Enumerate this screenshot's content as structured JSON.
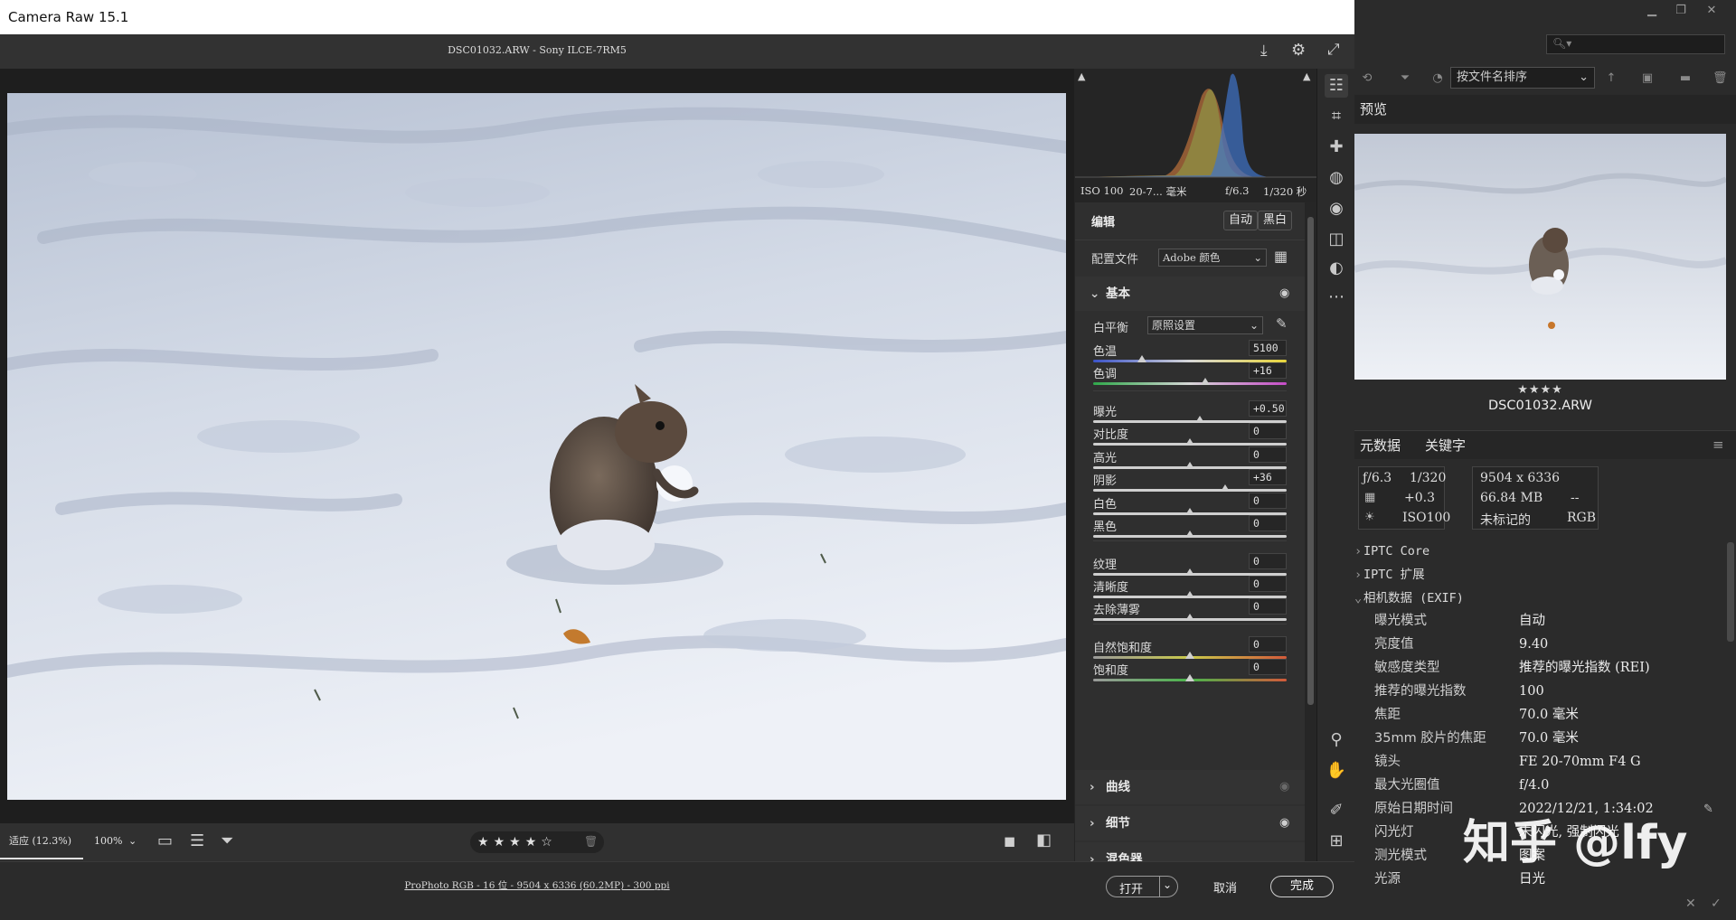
{
  "window": {
    "title": "Camera Raw 15.1",
    "file_header": "DSC01032.ARW -  Sony ILCE-7RM5"
  },
  "histogram": {
    "iso": "ISO 100",
    "focal": "20-7... 毫米",
    "aperture": "f/6.3",
    "shutter": "1/320 秒"
  },
  "edit_panel": {
    "edit_label": "编辑",
    "auto_button": "自动",
    "bw_button": "黑白",
    "profile_label": "配置文件",
    "profile_value": "Adobe 颜色",
    "basic_label": "基本",
    "wb_label": "白平衡",
    "wb_value": "原照设置",
    "sliders": [
      {
        "label": "色温",
        "value": "5100",
        "pos": 0.25
      },
      {
        "label": "色调",
        "value": "+16",
        "pos": 0.58
      },
      {
        "label": "曝光",
        "value": "+0.50",
        "pos": 0.55
      },
      {
        "label": "对比度",
        "value": "0",
        "pos": 0.5
      },
      {
        "label": "高光",
        "value": "0",
        "pos": 0.5
      },
      {
        "label": "阴影",
        "value": "+36",
        "pos": 0.68
      },
      {
        "label": "白色",
        "value": "0",
        "pos": 0.5
      },
      {
        "label": "黑色",
        "value": "0",
        "pos": 0.5
      },
      {
        "label": "纹理",
        "value": "0",
        "pos": 0.5
      },
      {
        "label": "清晰度",
        "value": "0",
        "pos": 0.5
      },
      {
        "label": "去除薄雾",
        "value": "0",
        "pos": 0.5
      },
      {
        "label": "自然饱和度",
        "value": "0",
        "pos": 0.5
      },
      {
        "label": "饱和度",
        "value": "0",
        "pos": 0.5
      }
    ],
    "curve_label": "曲线",
    "detail_label": "细节",
    "mixer_label": "混色器"
  },
  "toolbar": {
    "zoom_fit": "适应 (12.3%)",
    "zoom_pct": "100%",
    "rating_stars": 4
  },
  "footer": {
    "info_link": "ProPhoto RGB - 16 位 - 9504 x 6336 (60.2MP) - 300 ppi",
    "open_button": "打开",
    "cancel_button": "取消",
    "done_button": "完成"
  },
  "bridge": {
    "sort_value": "按文件名排序",
    "preview_tab": "预览",
    "preview_stars": "★★★★",
    "preview_filename": "DSC01032.ARW",
    "tabs": {
      "metadata": "元数据",
      "keywords": "关键字"
    },
    "meta_left": {
      "aperture": "ƒ/6.3",
      "shutter": "1/320",
      "ev": "+0.3",
      "iso": "ISO100"
    },
    "meta_right": {
      "dims": "9504 x 6336",
      "size": "66.84 MB",
      "dash": "--",
      "tagged": "未标记的",
      "mode": "RGB"
    },
    "tree": [
      {
        "label": "IPTC Core"
      },
      {
        "label": "IPTC 扩展"
      },
      {
        "label": "相机数据 (EXIF)"
      }
    ],
    "exif": [
      {
        "k": "曝光模式",
        "v": "自动"
      },
      {
        "k": "亮度值",
        "v": "9.40"
      },
      {
        "k": "敏感度类型",
        "v": "推荐的曝光指数 (REI)"
      },
      {
        "k": "推荐的曝光指数",
        "v": "100"
      },
      {
        "k": "焦距",
        "v": "70.0 毫米"
      },
      {
        "k": "35mm 胶片的焦距",
        "v": "70.0 毫米"
      },
      {
        "k": "镜头",
        "v": "FE 20-70mm F4 G"
      },
      {
        "k": "最大光圈值",
        "v": "f/4.0"
      },
      {
        "k": "原始日期时间",
        "v": "2022/12/21, 1:34:02"
      },
      {
        "k": "闪光灯",
        "v": "未闪光, 强制闪光"
      },
      {
        "k": "测光模式",
        "v": "图案"
      },
      {
        "k": "光源",
        "v": "日光"
      }
    ],
    "watermark": "知乎 @lfy"
  }
}
